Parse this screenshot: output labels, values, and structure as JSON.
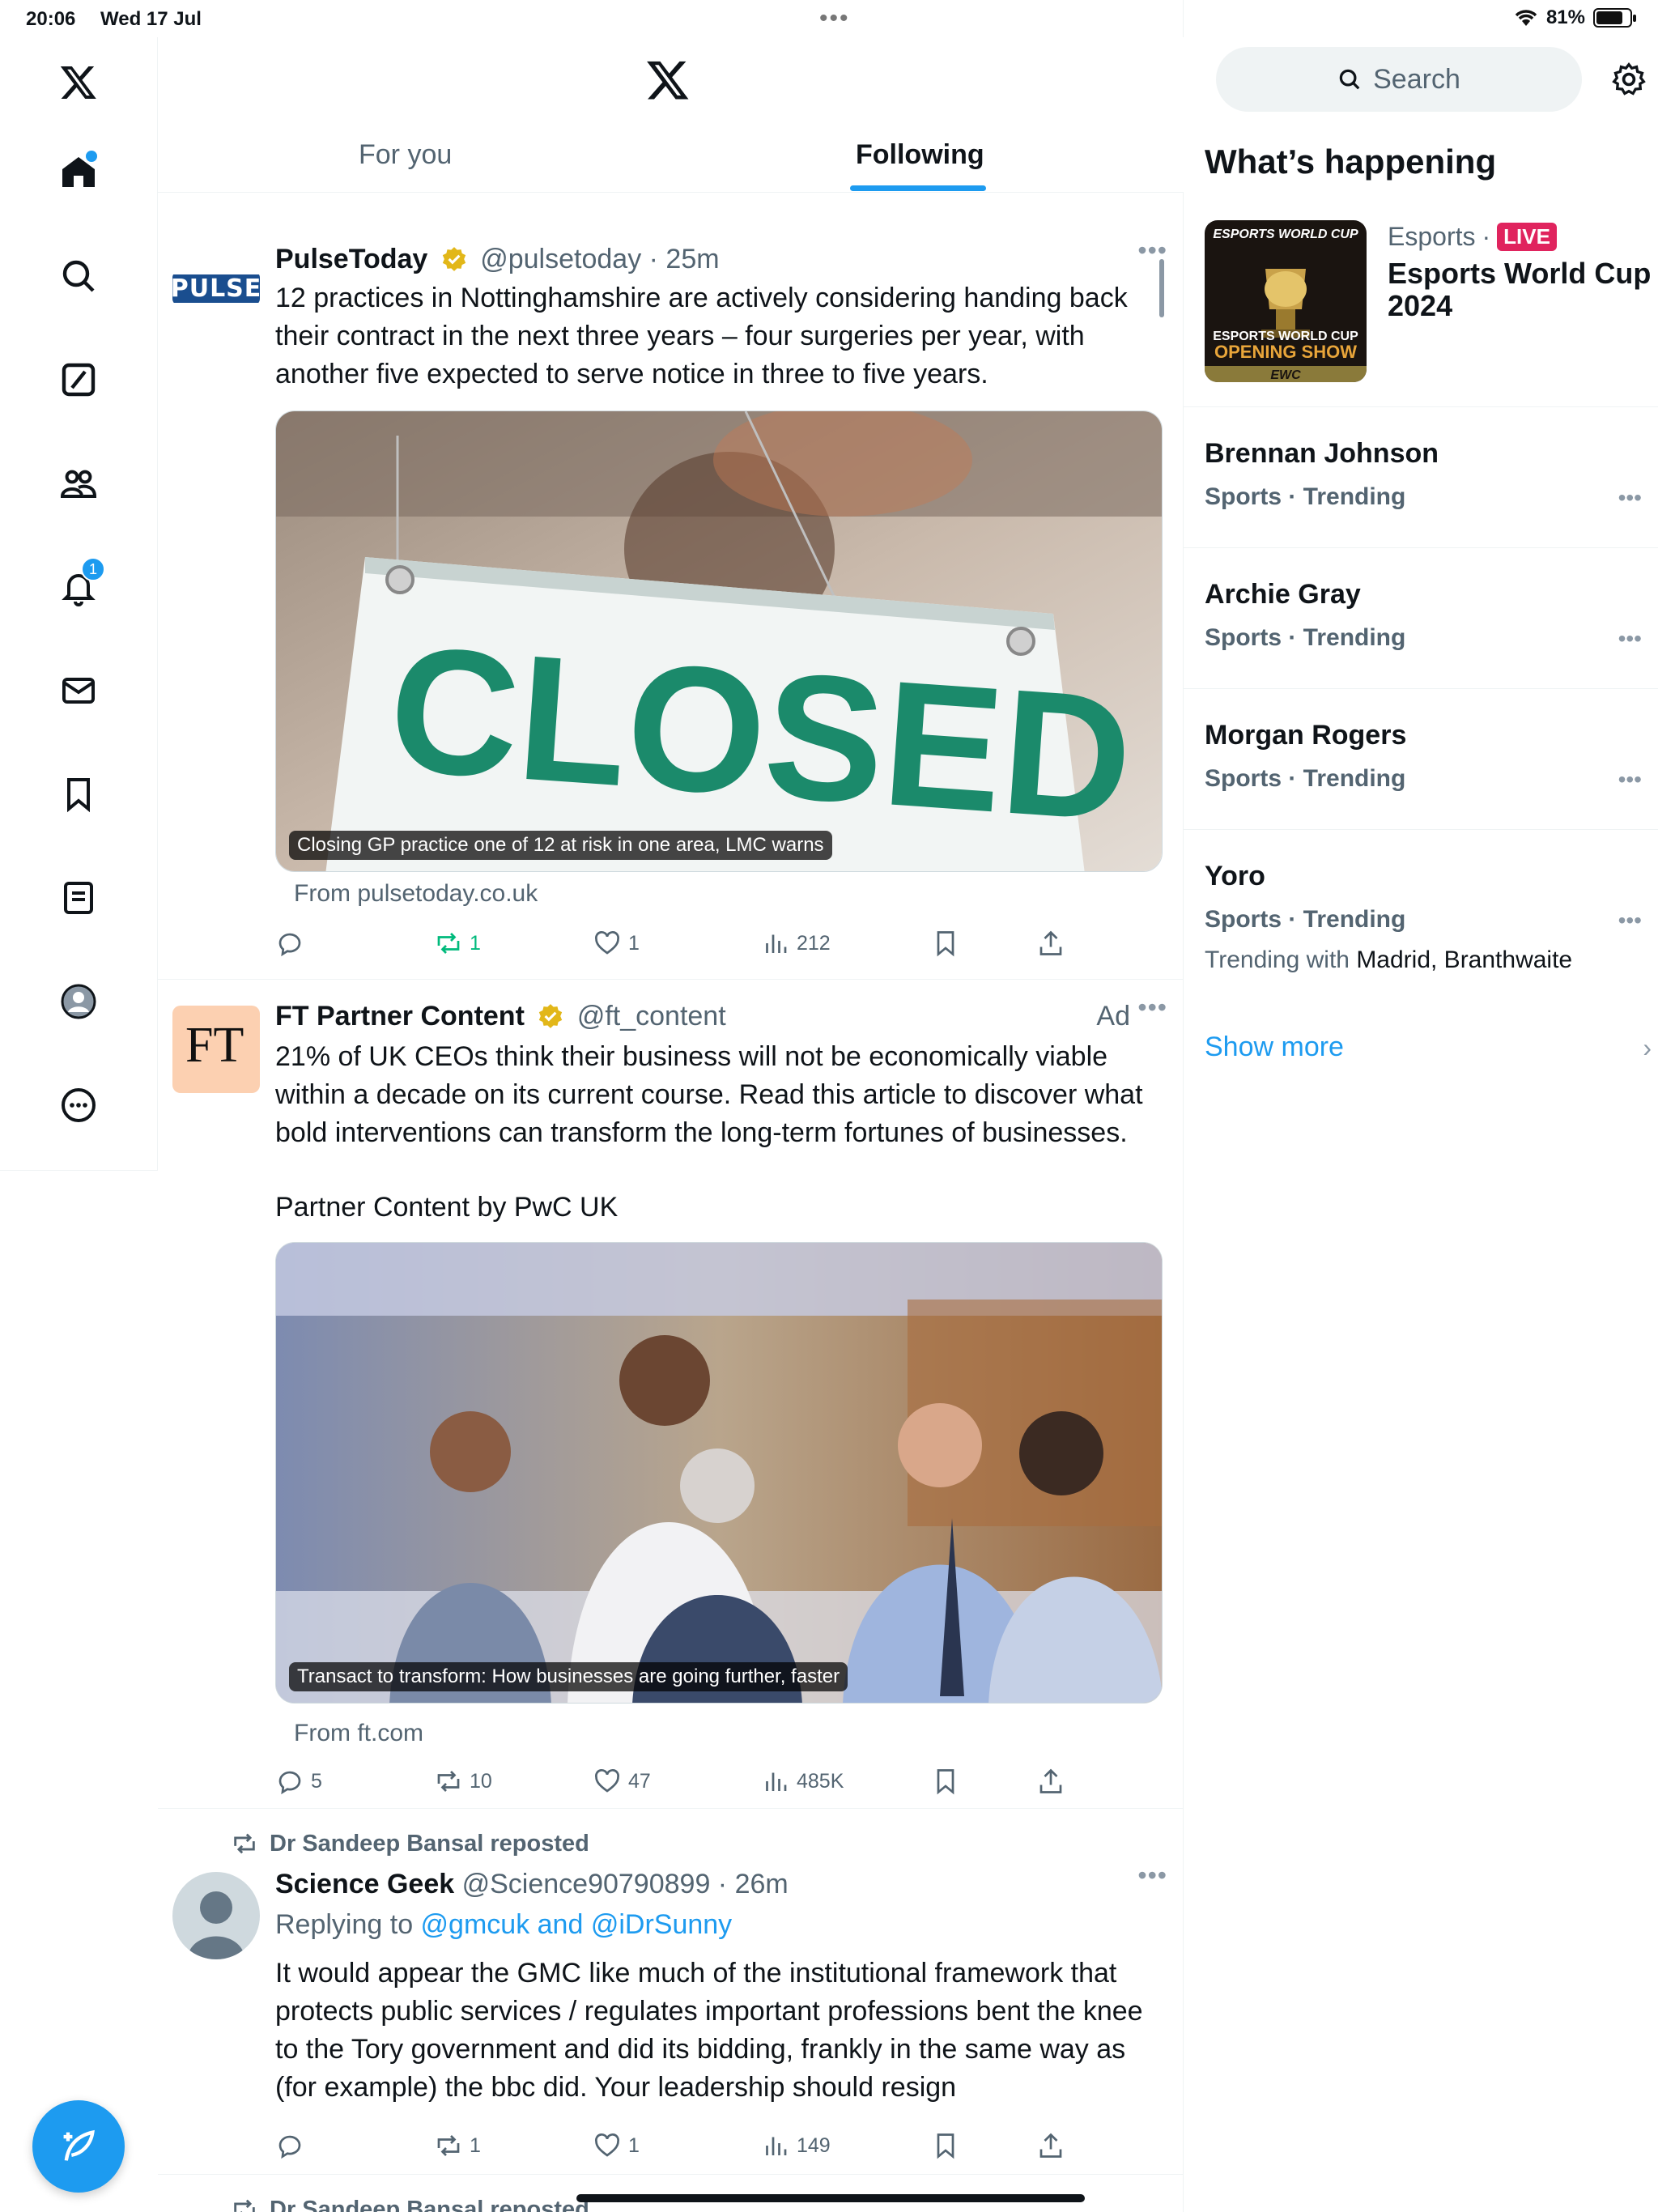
{
  "status": {
    "time": "20:06",
    "date": "Wed 17 Jul",
    "battery": "81%",
    "battery_level": 0.81
  },
  "header": {
    "tabs": [
      {
        "label": "For you"
      },
      {
        "label": "Following"
      }
    ]
  },
  "tweets": [
    {
      "name": "PulseToday",
      "handle": "@pulsetoday",
      "time": "25m",
      "avatar_text": "PULSE",
      "text": "12 practices in Nottinghamshire are actively considering handing back their contract in the next three years – four surgeries per year, with another five expected to serve notice in three to five years.",
      "media_caption": "Closing GP practice one of 12 at risk in one area, LMC warns",
      "media_word": "CLOSED",
      "from": "From pulsetoday.co.uk",
      "reposts": "1",
      "likes": "1",
      "views": "212"
    },
    {
      "name": "FT Partner Content",
      "handle": "@ft_content",
      "ad": "Ad",
      "avatar_text": "FT",
      "text": "21% of UK CEOs think their business will not be economically viable within a decade on its current course. Read this article to discover what bold interventions can transform the long-term fortunes of businesses.",
      "text2": "Partner Content by PwC UK",
      "media_caption": "Transact to transform: How businesses are going further, faster",
      "from": "From ft.com",
      "replies": "5",
      "reposts": "10",
      "likes": "47",
      "views": "485K"
    },
    {
      "repost_by": "Dr Sandeep Bansal reposted",
      "name": "Science Geek",
      "handle": "@Science90790899",
      "time": "26m",
      "reply_prefix": "Replying to ",
      "reply_to": "@gmcuk and @iDrSunny",
      "text": "It would appear the GMC like much of the institutional framework that protects public services / regulates important professions bent the knee to the Tory government and did its bidding, frankly in the same way as (for example) the bbc did. Your leadership should resign",
      "reposts": "1",
      "likes": "1",
      "views": "149"
    },
    {
      "repost_by": "Dr Sandeep Bansal reposted"
    }
  ],
  "sidebar": {
    "search_placeholder": "Search",
    "title": "What’s happening",
    "esports": {
      "category": "Esports",
      "live": "LIVE",
      "title": "Esports World Cup 2024",
      "img_top": "ESPORTS WORLD CUP",
      "img_line1": "ESPORTS WORLD CUP",
      "img_line2": "OPENING SHOW",
      "img_badge": "EWC"
    },
    "trends": [
      {
        "name": "Brennan Johnson",
        "meta": "Sports · Trending"
      },
      {
        "name": "Archie Gray",
        "meta": "Sports · Trending"
      },
      {
        "name": "Morgan Rogers",
        "meta": "Sports · Trending"
      },
      {
        "name": "Yoro",
        "meta": "Sports · Trending",
        "with_prefix": "Trending with ",
        "with": "Madrid, Branthwaite"
      }
    ],
    "show_more": "Show more"
  },
  "nav": {
    "notifications_badge": "1",
    "items": [
      "x-logo-icon",
      "home-icon",
      "search-icon",
      "grok-icon",
      "communities-icon",
      "notifications-icon",
      "messages-icon",
      "bookmarks-icon",
      "lists-icon",
      "profile-icon",
      "more-icon"
    ]
  },
  "colors": {
    "accent": "#1d9bf0",
    "repost_active": "#00ba7c",
    "live": "#e0245e",
    "text_secondary": "#536471"
  }
}
